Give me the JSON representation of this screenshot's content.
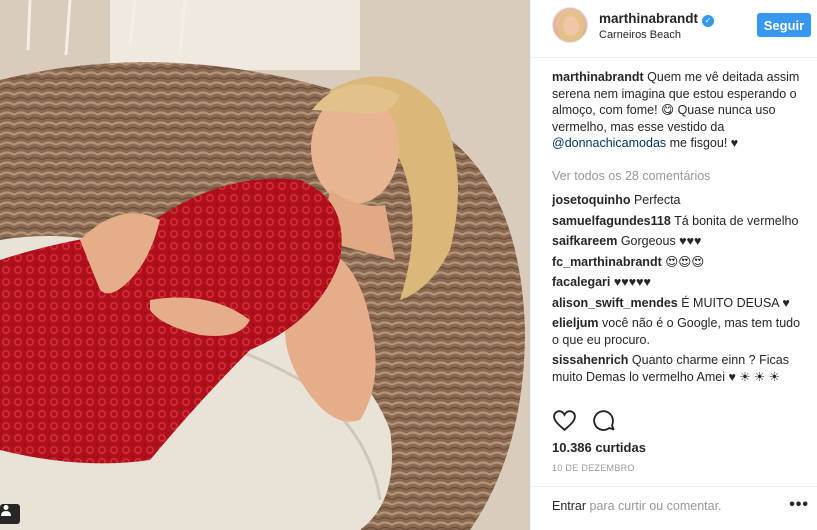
{
  "post": {
    "author": "marthinabrandt",
    "location": "Carneiros Beach",
    "follow_label": "Seguir",
    "caption_user": "marthinabrandt",
    "caption_text": "Quem me vê deitada assim serena nem imagina que estou esperando o almoço, com fome! 😋 Quase nunca uso vermelho, mas esse vestido da ",
    "caption_mention": "@donnachicamodas",
    "caption_end": " me fisgou! ♥",
    "view_all": "Ver todos os 28 comentários",
    "likes": "10.386 curtidas",
    "date": "10 DE DEZEMBRO",
    "add_comment_link": "Entrar",
    "add_comment_text": " para curtir ou comentar."
  },
  "comments": [
    {
      "user": "josetoquinho",
      "text": "Perfecta"
    },
    {
      "user": "samuelfagundes118",
      "text": "Tá bonita de vermelho"
    },
    {
      "user": "saifkareem",
      "text": "Gorgeous ♥♥♥"
    },
    {
      "user": "fc_marthinabrandt",
      "text": "😍😍😍"
    },
    {
      "user": "facalegari",
      "text": "♥♥♥♥♥"
    },
    {
      "user": "alison_swift_mendes",
      "text": "É MUITO DEUSA ♥"
    },
    {
      "user": "elieljum",
      "text": "você não é o Google, mas tem tudo o que eu procuro."
    },
    {
      "user": "sissahenrich",
      "text": "Quanto charme einn ? Ficas muito Demas lo vermelho Amei ♥ ☀ ☀ ☀"
    }
  ],
  "icons": {
    "like": "heart-icon",
    "comment": "comment-icon",
    "verified": "verified-badge-icon",
    "more": "more-options-icon",
    "user_tag": "user-tag-icon"
  },
  "colors": {
    "accent": "#3897f0",
    "mention": "#003569",
    "muted": "#999999"
  }
}
